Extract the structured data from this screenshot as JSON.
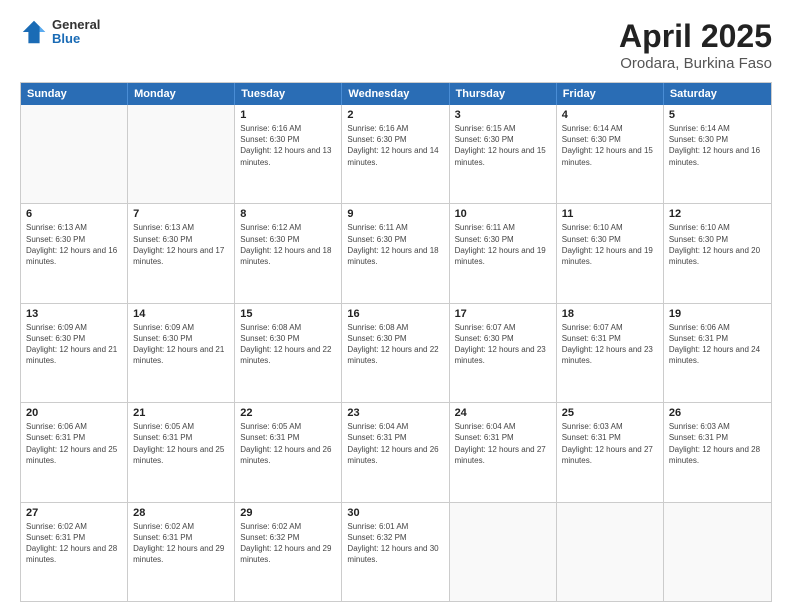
{
  "logo": {
    "general": "General",
    "blue": "Blue"
  },
  "title": "April 2025",
  "subtitle": "Orodara, Burkina Faso",
  "header_days": [
    "Sunday",
    "Monday",
    "Tuesday",
    "Wednesday",
    "Thursday",
    "Friday",
    "Saturday"
  ],
  "weeks": [
    [
      {
        "day": "",
        "info": ""
      },
      {
        "day": "",
        "info": ""
      },
      {
        "day": "1",
        "info": "Sunrise: 6:16 AM\nSunset: 6:30 PM\nDaylight: 12 hours and 13 minutes."
      },
      {
        "day": "2",
        "info": "Sunrise: 6:16 AM\nSunset: 6:30 PM\nDaylight: 12 hours and 14 minutes."
      },
      {
        "day": "3",
        "info": "Sunrise: 6:15 AM\nSunset: 6:30 PM\nDaylight: 12 hours and 15 minutes."
      },
      {
        "day": "4",
        "info": "Sunrise: 6:14 AM\nSunset: 6:30 PM\nDaylight: 12 hours and 15 minutes."
      },
      {
        "day": "5",
        "info": "Sunrise: 6:14 AM\nSunset: 6:30 PM\nDaylight: 12 hours and 16 minutes."
      }
    ],
    [
      {
        "day": "6",
        "info": "Sunrise: 6:13 AM\nSunset: 6:30 PM\nDaylight: 12 hours and 16 minutes."
      },
      {
        "day": "7",
        "info": "Sunrise: 6:13 AM\nSunset: 6:30 PM\nDaylight: 12 hours and 17 minutes."
      },
      {
        "day": "8",
        "info": "Sunrise: 6:12 AM\nSunset: 6:30 PM\nDaylight: 12 hours and 18 minutes."
      },
      {
        "day": "9",
        "info": "Sunrise: 6:11 AM\nSunset: 6:30 PM\nDaylight: 12 hours and 18 minutes."
      },
      {
        "day": "10",
        "info": "Sunrise: 6:11 AM\nSunset: 6:30 PM\nDaylight: 12 hours and 19 minutes."
      },
      {
        "day": "11",
        "info": "Sunrise: 6:10 AM\nSunset: 6:30 PM\nDaylight: 12 hours and 19 minutes."
      },
      {
        "day": "12",
        "info": "Sunrise: 6:10 AM\nSunset: 6:30 PM\nDaylight: 12 hours and 20 minutes."
      }
    ],
    [
      {
        "day": "13",
        "info": "Sunrise: 6:09 AM\nSunset: 6:30 PM\nDaylight: 12 hours and 21 minutes."
      },
      {
        "day": "14",
        "info": "Sunrise: 6:09 AM\nSunset: 6:30 PM\nDaylight: 12 hours and 21 minutes."
      },
      {
        "day": "15",
        "info": "Sunrise: 6:08 AM\nSunset: 6:30 PM\nDaylight: 12 hours and 22 minutes."
      },
      {
        "day": "16",
        "info": "Sunrise: 6:08 AM\nSunset: 6:30 PM\nDaylight: 12 hours and 22 minutes."
      },
      {
        "day": "17",
        "info": "Sunrise: 6:07 AM\nSunset: 6:30 PM\nDaylight: 12 hours and 23 minutes."
      },
      {
        "day": "18",
        "info": "Sunrise: 6:07 AM\nSunset: 6:31 PM\nDaylight: 12 hours and 23 minutes."
      },
      {
        "day": "19",
        "info": "Sunrise: 6:06 AM\nSunset: 6:31 PM\nDaylight: 12 hours and 24 minutes."
      }
    ],
    [
      {
        "day": "20",
        "info": "Sunrise: 6:06 AM\nSunset: 6:31 PM\nDaylight: 12 hours and 25 minutes."
      },
      {
        "day": "21",
        "info": "Sunrise: 6:05 AM\nSunset: 6:31 PM\nDaylight: 12 hours and 25 minutes."
      },
      {
        "day": "22",
        "info": "Sunrise: 6:05 AM\nSunset: 6:31 PM\nDaylight: 12 hours and 26 minutes."
      },
      {
        "day": "23",
        "info": "Sunrise: 6:04 AM\nSunset: 6:31 PM\nDaylight: 12 hours and 26 minutes."
      },
      {
        "day": "24",
        "info": "Sunrise: 6:04 AM\nSunset: 6:31 PM\nDaylight: 12 hours and 27 minutes."
      },
      {
        "day": "25",
        "info": "Sunrise: 6:03 AM\nSunset: 6:31 PM\nDaylight: 12 hours and 27 minutes."
      },
      {
        "day": "26",
        "info": "Sunrise: 6:03 AM\nSunset: 6:31 PM\nDaylight: 12 hours and 28 minutes."
      }
    ],
    [
      {
        "day": "27",
        "info": "Sunrise: 6:02 AM\nSunset: 6:31 PM\nDaylight: 12 hours and 28 minutes."
      },
      {
        "day": "28",
        "info": "Sunrise: 6:02 AM\nSunset: 6:31 PM\nDaylight: 12 hours and 29 minutes."
      },
      {
        "day": "29",
        "info": "Sunrise: 6:02 AM\nSunset: 6:32 PM\nDaylight: 12 hours and 29 minutes."
      },
      {
        "day": "30",
        "info": "Sunrise: 6:01 AM\nSunset: 6:32 PM\nDaylight: 12 hours and 30 minutes."
      },
      {
        "day": "",
        "info": ""
      },
      {
        "day": "",
        "info": ""
      },
      {
        "day": "",
        "info": ""
      }
    ]
  ]
}
